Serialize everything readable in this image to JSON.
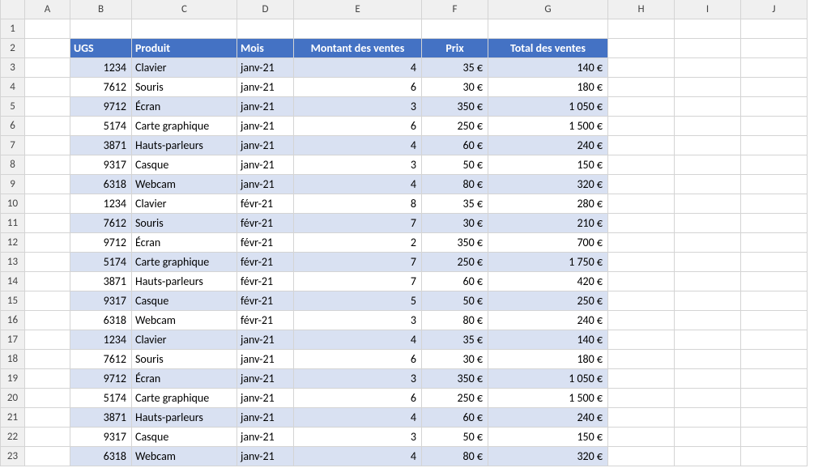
{
  "columns": [
    "A",
    "B",
    "C",
    "D",
    "E",
    "F",
    "G",
    "H",
    "I",
    "J"
  ],
  "rowCount": 23,
  "headers": {
    "ugs": "UGS",
    "produit": "Produit",
    "mois": "Mois",
    "montant": "Montant des ventes",
    "prix": "Prix",
    "total": "Total des ventes"
  },
  "rows": [
    {
      "ugs": "1234",
      "produit": "Clavier",
      "mois": "janv-21",
      "montant": "4",
      "prix": "35 €",
      "total": "140 €",
      "band": true
    },
    {
      "ugs": "7612",
      "produit": "Souris",
      "mois": "janv-21",
      "montant": "6",
      "prix": "30 €",
      "total": "180 €",
      "band": false
    },
    {
      "ugs": "9712",
      "produit": "Écran",
      "mois": "janv-21",
      "montant": "3",
      "prix": "350 €",
      "total": "1 050 €",
      "band": true
    },
    {
      "ugs": "5174",
      "produit": "Carte graphique",
      "mois": "janv-21",
      "montant": "6",
      "prix": "250 €",
      "total": "1 500 €",
      "band": false
    },
    {
      "ugs": "3871",
      "produit": "Hauts-parleurs",
      "mois": "janv-21",
      "montant": "4",
      "prix": "60 €",
      "total": "240 €",
      "band": true
    },
    {
      "ugs": "9317",
      "produit": "Casque",
      "mois": "janv-21",
      "montant": "3",
      "prix": "50 €",
      "total": "150 €",
      "band": false
    },
    {
      "ugs": "6318",
      "produit": "Webcam",
      "mois": "janv-21",
      "montant": "4",
      "prix": "80 €",
      "total": "320 €",
      "band": true
    },
    {
      "ugs": "1234",
      "produit": "Clavier",
      "mois": "févr-21",
      "montant": "8",
      "prix": "35 €",
      "total": "280 €",
      "band": false
    },
    {
      "ugs": "7612",
      "produit": "Souris",
      "mois": "févr-21",
      "montant": "7",
      "prix": "30 €",
      "total": "210 €",
      "band": true
    },
    {
      "ugs": "9712",
      "produit": "Écran",
      "mois": "févr-21",
      "montant": "2",
      "prix": "350 €",
      "total": "700 €",
      "band": false
    },
    {
      "ugs": "5174",
      "produit": "Carte graphique",
      "mois": "févr-21",
      "montant": "7",
      "prix": "250 €",
      "total": "1 750 €",
      "band": true
    },
    {
      "ugs": "3871",
      "produit": "Hauts-parleurs",
      "mois": "févr-21",
      "montant": "7",
      "prix": "60 €",
      "total": "420 €",
      "band": false
    },
    {
      "ugs": "9317",
      "produit": "Casque",
      "mois": "févr-21",
      "montant": "5",
      "prix": "50 €",
      "total": "250 €",
      "band": true
    },
    {
      "ugs": "6318",
      "produit": "Webcam",
      "mois": "févr-21",
      "montant": "3",
      "prix": "80 €",
      "total": "240 €",
      "band": false
    },
    {
      "ugs": "1234",
      "produit": "Clavier",
      "mois": "janv-21",
      "montant": "4",
      "prix": "35 €",
      "total": "140 €",
      "band": true
    },
    {
      "ugs": "7612",
      "produit": "Souris",
      "mois": "janv-21",
      "montant": "6",
      "prix": "30 €",
      "total": "180 €",
      "band": false
    },
    {
      "ugs": "9712",
      "produit": "Écran",
      "mois": "janv-21",
      "montant": "3",
      "prix": "350 €",
      "total": "1 050 €",
      "band": true
    },
    {
      "ugs": "5174",
      "produit": "Carte graphique",
      "mois": "janv-21",
      "montant": "6",
      "prix": "250 €",
      "total": "1 500 €",
      "band": false
    },
    {
      "ugs": "3871",
      "produit": "Hauts-parleurs",
      "mois": "janv-21",
      "montant": "4",
      "prix": "60 €",
      "total": "240 €",
      "band": true
    },
    {
      "ugs": "9317",
      "produit": "Casque",
      "mois": "janv-21",
      "montant": "3",
      "prix": "50 €",
      "total": "150 €",
      "band": false
    },
    {
      "ugs": "6318",
      "produit": "Webcam",
      "mois": "janv-21",
      "montant": "4",
      "prix": "80 €",
      "total": "320 €",
      "band": true
    }
  ]
}
